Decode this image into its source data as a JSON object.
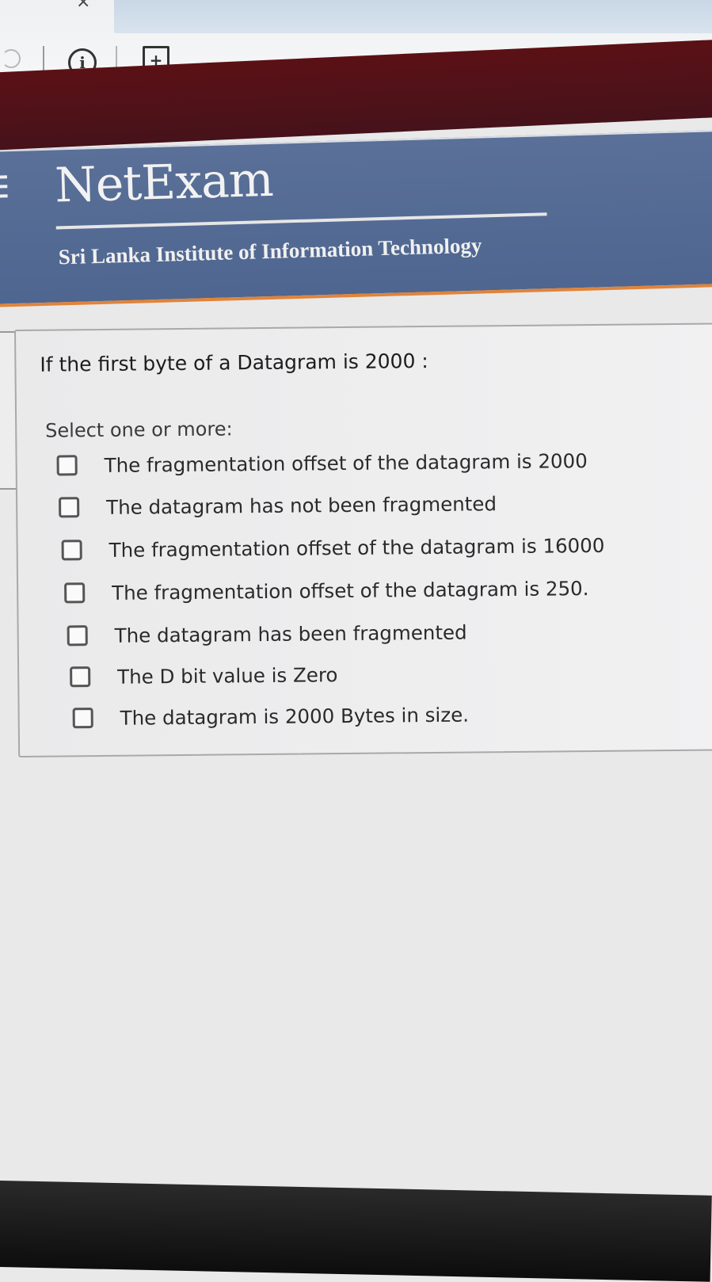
{
  "browser": {
    "close_glyph": "×",
    "info_glyph": "i",
    "new_page_glyph": "+"
  },
  "header": {
    "logo": "NetExam",
    "institute": "Sri Lanka Institute of Information Technology"
  },
  "question": {
    "text": "If the first byte of a Datagram is 2000 :",
    "prompt": "Select one or more:",
    "options": [
      {
        "label": "The fragmentation offset of the datagram is 2000",
        "checked": false
      },
      {
        "label": "The datagram has not been fragmented",
        "checked": false
      },
      {
        "label": "The fragmentation offset of the datagram is 16000",
        "checked": false
      },
      {
        "label": "The fragmentation offset of the datagram is 250.",
        "checked": false
      },
      {
        "label": "The datagram has been fragmented",
        "checked": false
      },
      {
        "label": "The D bit value is Zero",
        "checked": false
      },
      {
        "label": "The datagram is 2000 Bytes in size.",
        "checked": false
      }
    ]
  },
  "colors": {
    "maroon": "#4f1219",
    "header_blue": "#5a7098",
    "accent_orange": "#e0843a"
  }
}
